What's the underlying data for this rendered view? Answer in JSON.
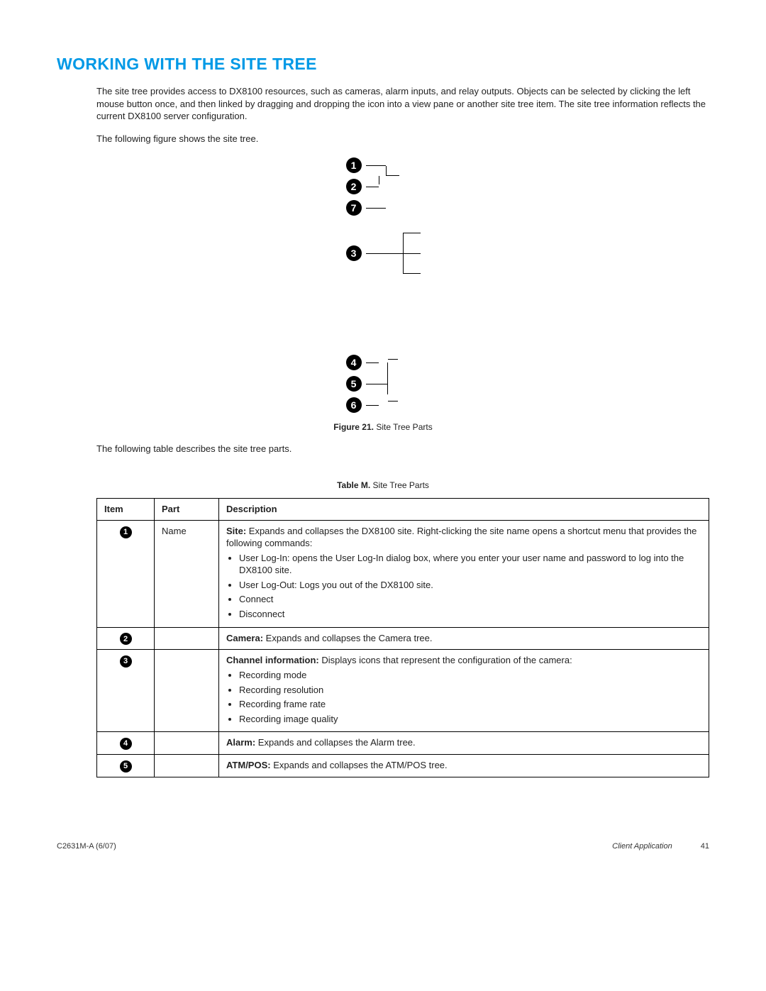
{
  "heading": "WORKING WITH THE SITE TREE",
  "intro_para": "The site tree provides access to DX8100 resources, such as cameras, alarm inputs, and relay outputs. Objects can be selected by clicking the left mouse button once, and then linked by dragging and dropping the icon into a view pane or another site tree item. The site tree information reflects the current DX8100 server configuration.",
  "intro_line2": "The following figure shows the site tree.",
  "figure": {
    "label": "Figure 21.",
    "title": "Site Tree Parts",
    "top_callouts": [
      "1",
      "2",
      "7",
      "3"
    ],
    "bottom_callouts": [
      "4",
      "5",
      "6"
    ]
  },
  "table_intro": "The following table describes the site tree parts.",
  "table": {
    "label": "Table M.",
    "title": "Site Tree Parts",
    "headers": {
      "item": "Item",
      "part": "Part",
      "description": "Description"
    },
    "rows": [
      {
        "num": "1",
        "part": "Name",
        "lead_bold": "Site:",
        "lead_rest": " Expands and collapses the DX8100 site. Right-clicking the site name opens a shortcut menu that provides the following commands:",
        "bullets": [
          "User Log-In: opens the User Log-In dialog box, where you enter your user name and password to log into the DX8100 site.",
          "User Log-Out: Logs you out of the DX8100 site.",
          "Connect",
          "Disconnect"
        ]
      },
      {
        "num": "2",
        "part": "",
        "lead_bold": "Camera:",
        "lead_rest": " Expands and collapses the Camera tree.",
        "bullets": []
      },
      {
        "num": "3",
        "part": "",
        "lead_bold": "Channel information:",
        "lead_rest": " Displays icons that represent the configuration of the camera:",
        "bullets": [
          "Recording mode",
          "Recording resolution",
          "Recording frame rate",
          "Recording image quality"
        ]
      },
      {
        "num": "4",
        "part": "",
        "lead_bold": "Alarm:",
        "lead_rest": " Expands and collapses the Alarm tree.",
        "bullets": []
      },
      {
        "num": "5",
        "part": "",
        "lead_bold": "ATM/POS:",
        "lead_rest": " Expands and collapses the ATM/POS tree.",
        "bullets": []
      }
    ]
  },
  "footer": {
    "left": "C2631M-A (6/07)",
    "section": "Client Application",
    "page": "41"
  }
}
